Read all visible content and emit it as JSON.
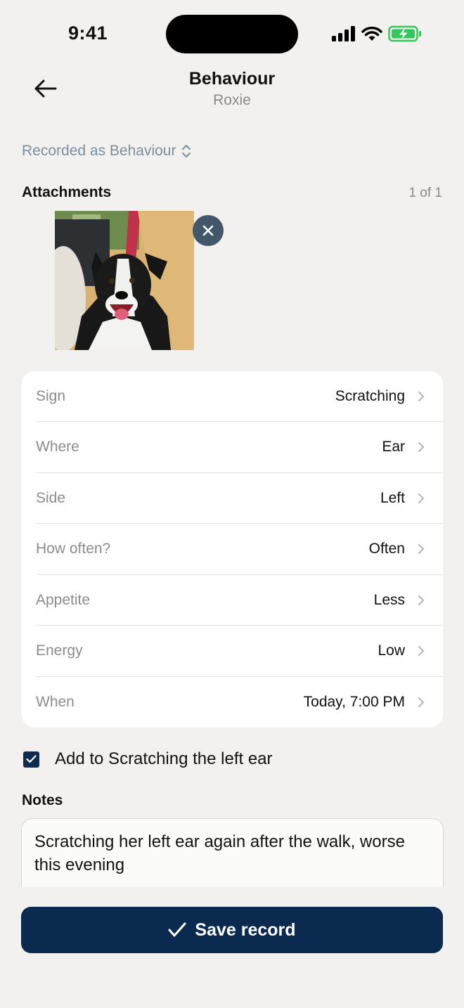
{
  "status_bar": {
    "time": "9:41",
    "icons": [
      "signal-icon",
      "wifi-icon",
      "battery-charging-icon"
    ],
    "battery_color": "#34c759"
  },
  "header": {
    "title": "Behaviour",
    "subtitle": "Roxie",
    "back_icon": "arrow-left-icon"
  },
  "record_type": {
    "label": "Recorded as Behaviour",
    "icon": "chevron-updown-icon",
    "color": "#7b8ea0"
  },
  "attachments": {
    "title": "Attachments",
    "count": "1 of 1",
    "items": [
      {
        "icon": "dog-photo",
        "remove_icon": "close-icon"
      }
    ]
  },
  "details": {
    "rows": [
      {
        "label": "Sign",
        "value": "Scratching"
      },
      {
        "label": "Where",
        "value": "Ear"
      },
      {
        "label": "Side",
        "value": "Left"
      },
      {
        "label": "How often?",
        "value": "Often"
      },
      {
        "label": "Appetite",
        "value": "Less"
      },
      {
        "label": "Energy",
        "value": "Low"
      },
      {
        "label": "When",
        "value": "Today, 7:00 PM"
      }
    ]
  },
  "add_to": {
    "label": "Add to Scratching the left ear",
    "checked": true
  },
  "notes": {
    "title": "Notes",
    "value": "Scratching her left ear again after the walk, worse this evening"
  },
  "save_button": {
    "label": "Save record",
    "icon": "checkmark-icon",
    "color": "#0a2a4f"
  }
}
